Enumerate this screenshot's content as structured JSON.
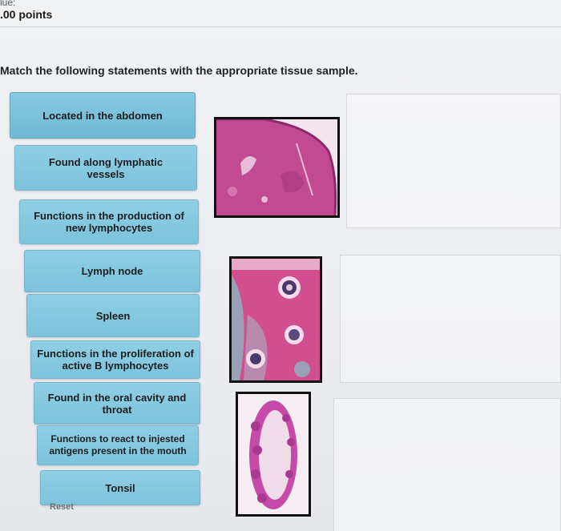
{
  "header": {
    "value_label": "lue:",
    "points": ".00 points"
  },
  "instruction": "Match the following statements with the appropriate tissue sample.",
  "statements": [
    {
      "label": "Located in the abdomen"
    },
    {
      "label": "Found along lymphatic vessels"
    },
    {
      "label": "Functions in the production of new lymphocytes"
    },
    {
      "label": "Lymph node"
    },
    {
      "label": "Spleen"
    },
    {
      "label": "Functions in the proliferation of active B lymphocytes"
    },
    {
      "label": "Found in the oral cavity and throat"
    },
    {
      "label": "Functions to react to injested antigens present in the mouth"
    },
    {
      "label": "Tonsil"
    }
  ],
  "tissue_samples": [
    {
      "stain_primary": "#c14a93",
      "stain_secondary": "#e7bcd8"
    },
    {
      "stain_primary": "#d24f8f",
      "stain_secondary": "#9aa0b8"
    },
    {
      "stain_primary": "#c64aa7",
      "stain_secondary": "#f1dde9"
    }
  ],
  "reset_label": "Reset",
  "colors": {
    "statement_fill": "#85c8df",
    "statement_border": "#7db3c7",
    "background": "#eceef1"
  }
}
